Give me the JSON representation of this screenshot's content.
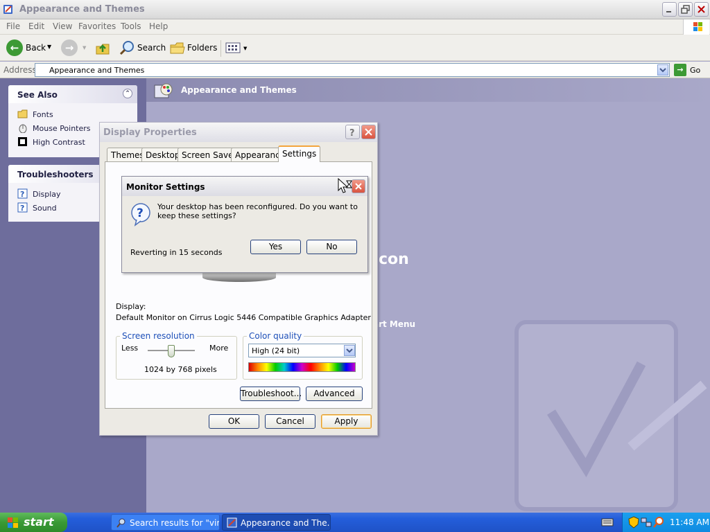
{
  "window": {
    "title": "Appearance and Themes",
    "menu": [
      "File",
      "Edit",
      "View",
      "Favorites",
      "Tools",
      "Help"
    ]
  },
  "toolbar": {
    "back_label": "Back",
    "search_label": "Search",
    "folders_label": "Folders"
  },
  "address": {
    "label": "Address",
    "value": "Appearance and Themes",
    "go_label": "Go"
  },
  "see_also": {
    "title": "See Also",
    "items": [
      {
        "label": "Fonts",
        "icon": "folder-fonts-icon"
      },
      {
        "label": "Mouse Pointers",
        "icon": "mouse-icon"
      },
      {
        "label": "High Contrast",
        "icon": "contrast-icon"
      }
    ]
  },
  "troubleshooters": {
    "title": "Troubleshooters",
    "items": [
      {
        "label": "Display",
        "icon": "help-icon"
      },
      {
        "label": "Sound",
        "icon": "help-icon"
      }
    ]
  },
  "content": {
    "header": "Appearance and Themes",
    "bg_text_1": "con",
    "bg_text_2": "art Menu"
  },
  "display_properties": {
    "title": "Display Properties",
    "tabs": [
      "Themes",
      "Desktop",
      "Screen Saver",
      "Appearance",
      "Settings"
    ],
    "active_tab": "Settings",
    "display_label": "Display:",
    "display_value": "Default Monitor on Cirrus Logic 5446 Compatible Graphics Adapter",
    "resolution": {
      "group_label": "Screen resolution",
      "less": "Less",
      "more": "More",
      "value": "1024 by 768 pixels"
    },
    "color_quality": {
      "group_label": "Color quality",
      "selected": "High (24 bit)"
    },
    "buttons": {
      "troubleshoot": "Troubleshoot...",
      "advanced": "Advanced",
      "ok": "OK",
      "cancel": "Cancel",
      "apply": "Apply"
    }
  },
  "monitor_settings": {
    "title": "Monitor Settings",
    "message": "Your desktop has been reconfigured.  Do you want to keep these settings?",
    "countdown": "Reverting in 15 seconds",
    "yes": "Yes",
    "no": "No"
  },
  "taskbar": {
    "start_label": "start",
    "tasks": [
      "Search results for \"vir...",
      "Appearance and The..."
    ],
    "clock": "11:48 AM"
  },
  "colors": {
    "content_bg": "#a9a8c9",
    "taskbar_blue": "#245edb",
    "start_green": "#3a9a35"
  }
}
